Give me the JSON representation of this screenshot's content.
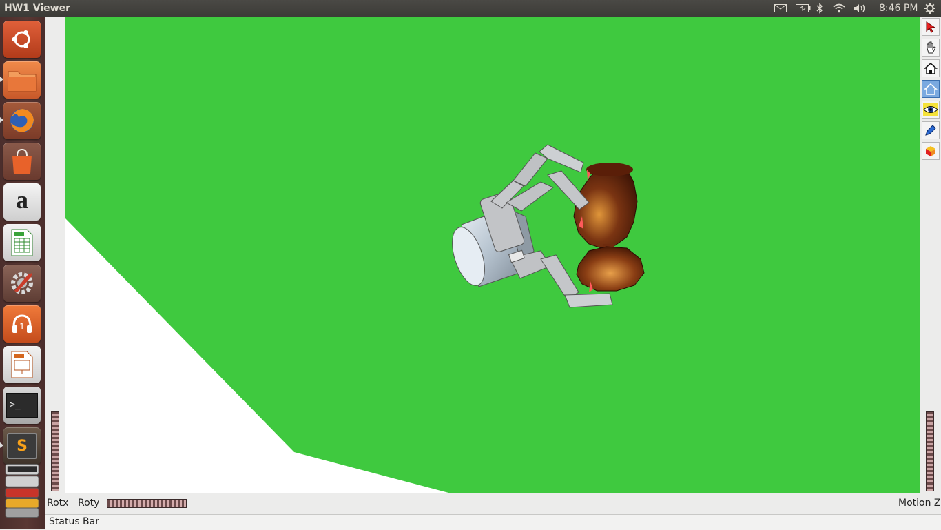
{
  "window": {
    "title": "HW1 Viewer"
  },
  "top_panel": {
    "clock": "8:46 PM",
    "indicators": [
      "mail-icon",
      "battery-icon",
      "bluetooth-icon",
      "wifi-icon",
      "volume-icon",
      "power-gear-icon"
    ]
  },
  "launcher": {
    "items": [
      {
        "name": "ubuntu-dash",
        "icon": "ubuntu-logo-icon"
      },
      {
        "name": "files",
        "icon": "folder-icon"
      },
      {
        "name": "firefox",
        "icon": "firefox-icon"
      },
      {
        "name": "software-center",
        "icon": "shopping-bag-icon"
      },
      {
        "name": "amazon",
        "icon": "amazon-icon"
      },
      {
        "name": "libreoffice-calc",
        "icon": "spreadsheet-icon"
      },
      {
        "name": "system-settings",
        "icon": "settings-wrench-icon"
      },
      {
        "name": "ubuntu-one-music",
        "icon": "music-headphones-icon"
      },
      {
        "name": "libreoffice-impress",
        "icon": "presentation-icon"
      },
      {
        "name": "terminal",
        "icon": "terminal-icon",
        "label": ">_"
      },
      {
        "name": "sublime-text",
        "icon": "sublime-icon",
        "label": "S"
      },
      {
        "name": "stacked-apps",
        "icon": "stacked-apps-icon"
      }
    ],
    "amazon_label": "a"
  },
  "viewer": {
    "label_rotx": "Rotx",
    "label_roty": "Roty",
    "label_motionz": "Motion Z",
    "status": "Status Bar",
    "colors": {
      "background": "#3fc93f",
      "floor": "#ffffff",
      "gripper": "#b8babd",
      "glass": "#6b2a10"
    }
  },
  "toolbar": {
    "tools": [
      {
        "name": "select-arrow-icon",
        "active": false
      },
      {
        "name": "hand-pan-icon",
        "active": false
      },
      {
        "name": "home-icon",
        "active": false
      },
      {
        "name": "set-home-icon",
        "active": true
      },
      {
        "name": "view-all-eye-icon",
        "active": false
      },
      {
        "name": "seek-icon",
        "active": false
      },
      {
        "name": "projection-cube-icon",
        "active": false
      }
    ]
  }
}
